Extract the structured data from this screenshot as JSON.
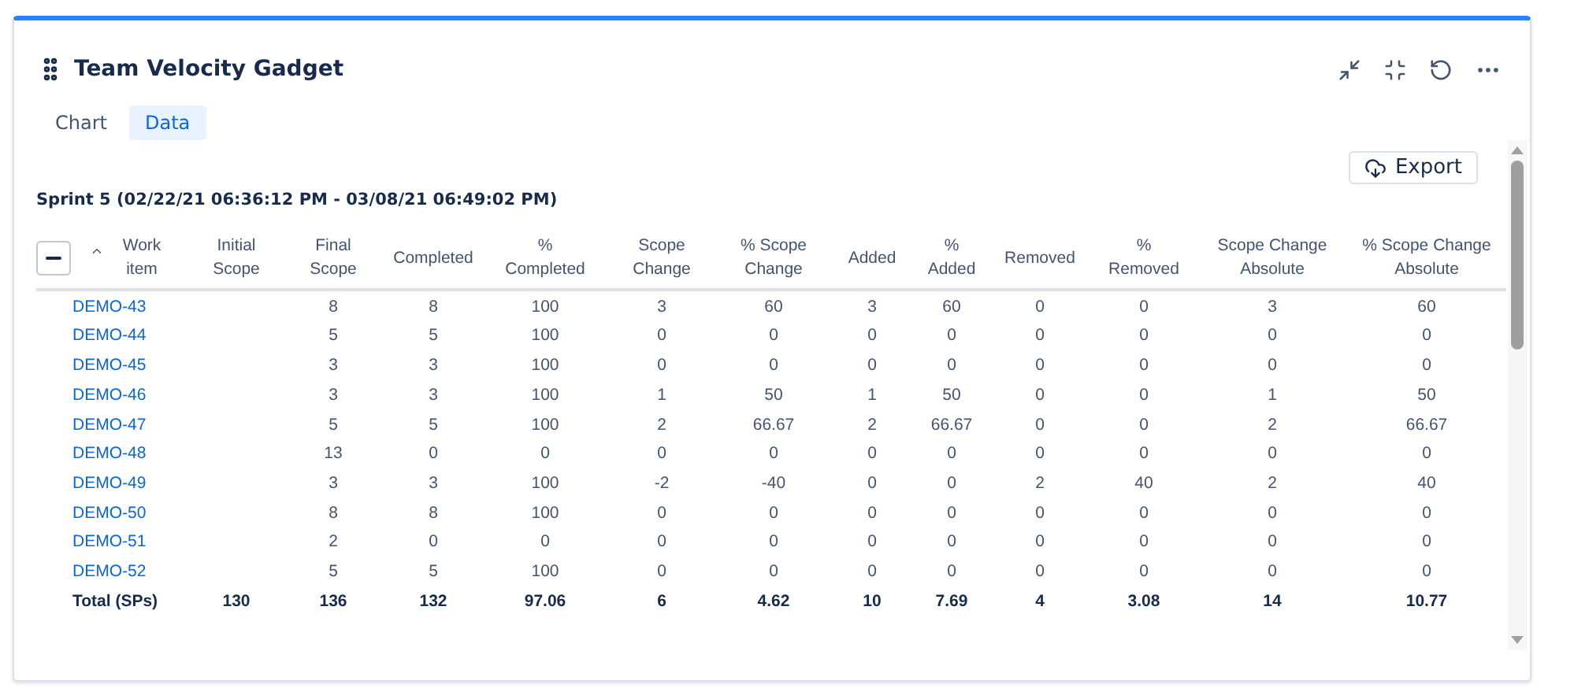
{
  "title": "Team Velocity Gadget",
  "tabs": [
    {
      "label": "Chart",
      "selected": false
    },
    {
      "label": "Data",
      "selected": true
    }
  ],
  "export_button": "Export",
  "sprint_label": "Sprint 5 (02/22/21 06:36:12 PM - 03/08/21 06:49:02 PM)",
  "table": {
    "expanded": true,
    "columns": [
      {
        "label": "Work item",
        "sorted": true
      },
      {
        "label": "Initial Scope",
        "sorted": false
      },
      {
        "label": "Final Scope",
        "sorted": false
      },
      {
        "label": "Completed",
        "sorted": false
      },
      {
        "label": "% Completed",
        "sorted": false
      },
      {
        "label": "Scope Change",
        "sorted": false
      },
      {
        "label": "% Scope Change",
        "sorted": false
      },
      {
        "label": "Added",
        "sorted": false
      },
      {
        "label": "% Added",
        "sorted": false
      },
      {
        "label": "Removed",
        "sorted": false
      },
      {
        "label": "% Removed",
        "sorted": false
      },
      {
        "label": "Scope Change Absolute",
        "sorted": false
      },
      {
        "label": "% Scope Change Absolute",
        "sorted": false
      }
    ],
    "rows": [
      {
        "cells": [
          "DEMO-43",
          "",
          "8",
          "8",
          "100",
          "3",
          "60",
          "3",
          "60",
          "0",
          "0",
          "3",
          "60"
        ]
      },
      {
        "cells": [
          "DEMO-44",
          "",
          "5",
          "5",
          "100",
          "0",
          "0",
          "0",
          "0",
          "0",
          "0",
          "0",
          "0"
        ]
      },
      {
        "cells": [
          "DEMO-45",
          "",
          "3",
          "3",
          "100",
          "0",
          "0",
          "0",
          "0",
          "0",
          "0",
          "0",
          "0"
        ]
      },
      {
        "cells": [
          "DEMO-46",
          "",
          "3",
          "3",
          "100",
          "1",
          "50",
          "1",
          "50",
          "0",
          "0",
          "1",
          "50"
        ]
      },
      {
        "cells": [
          "DEMO-47",
          "",
          "5",
          "5",
          "100",
          "2",
          "66.67",
          "2",
          "66.67",
          "0",
          "0",
          "2",
          "66.67"
        ]
      },
      {
        "cells": [
          "DEMO-48",
          "",
          "13",
          "0",
          "0",
          "0",
          "0",
          "0",
          "0",
          "0",
          "0",
          "0",
          "0"
        ]
      },
      {
        "cells": [
          "DEMO-49",
          "",
          "3",
          "3",
          "100",
          "-2",
          "-40",
          "0",
          "0",
          "2",
          "40",
          "2",
          "40"
        ]
      },
      {
        "cells": [
          "DEMO-50",
          "",
          "8",
          "8",
          "100",
          "0",
          "0",
          "0",
          "0",
          "0",
          "0",
          "0",
          "0"
        ]
      },
      {
        "cells": [
          "DEMO-51",
          "",
          "2",
          "0",
          "0",
          "0",
          "0",
          "0",
          "0",
          "0",
          "0",
          "0",
          "0"
        ]
      },
      {
        "cells": [
          "DEMO-52",
          "",
          "5",
          "5",
          "100",
          "0",
          "0",
          "0",
          "0",
          "0",
          "0",
          "0",
          "0"
        ]
      }
    ],
    "total": {
      "cells": [
        "Total (SPs)",
        "130",
        "136",
        "132",
        "97.06",
        "6",
        "4.62",
        "10",
        "7.69",
        "4",
        "3.08",
        "14",
        "10.77"
      ]
    }
  }
}
